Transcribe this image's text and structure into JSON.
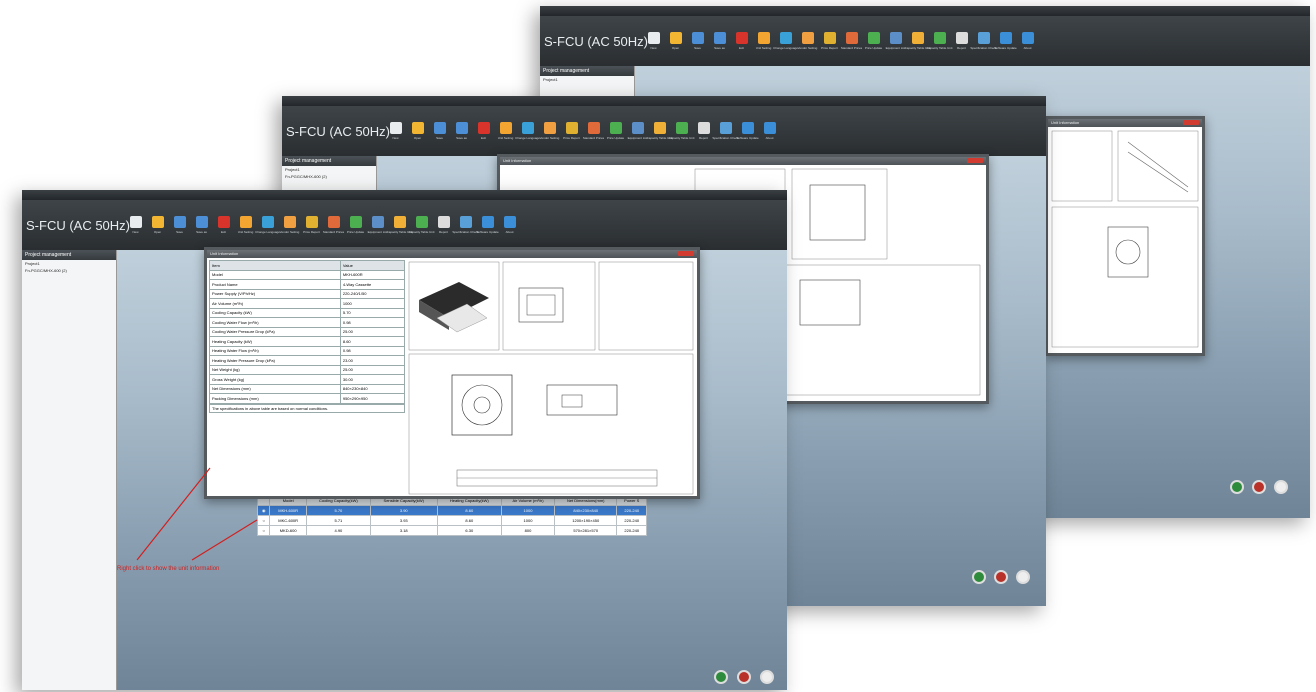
{
  "app_title": "S-FCU (AC 50Hz)",
  "toolbar": [
    "New",
    "Open",
    "Save",
    "Save as",
    "Exit",
    "Unit Setting",
    "Change Language",
    "Vendor Setting",
    "Price Report",
    "Standard Prices",
    "Price Update",
    "Equipment List",
    "Capacity Table Unit",
    "Capacity Table Unit",
    "Report",
    "Specification Check",
    "Software Update",
    "About"
  ],
  "sidebar": {
    "header": "Project management",
    "project": "Project1",
    "item": "Fn-PGGC/MHX-600 (2)"
  },
  "dialog": {
    "title": "Unit Information",
    "spec_header": [
      "Item",
      "Value"
    ],
    "specs": [
      [
        "Model",
        "MKH-600R"
      ],
      [
        "Product Name",
        "4-Way Cassette"
      ],
      [
        "Power Supply (V/Ph/Hz)",
        "220-240/1/50"
      ],
      [
        "Air Volume (m³/h)",
        "1000"
      ],
      [
        "Cooling Capacity (kW)",
        "5.70"
      ],
      [
        "Cooling Water Flow (m³/h)",
        "0.98"
      ],
      [
        "Cooling Water Pressure Drop (kPa)",
        "25.00"
      ],
      [
        "Heating Capacity (kW)",
        "8.60"
      ],
      [
        "Heating Water Flow (m³/h)",
        "0.98"
      ],
      [
        "Heating Water Pressure Drop (kPa)",
        "23.00"
      ],
      [
        "Net Weight (kg)",
        "25.00"
      ],
      [
        "Gross Weight (kg)",
        "30.00"
      ],
      [
        "Net Dimensions (mm)",
        "840×230×840"
      ],
      [
        "Packing Dimensions (mm)",
        "950×290×950"
      ]
    ],
    "footnote": "The specifications in above table are based on normal conditions."
  },
  "grid": {
    "headers": [
      "Model",
      "Cooling Capacity(kW)",
      "Sensible Capacity(kW)",
      "Heating Capacity(kW)",
      "Air Volume (m³/h)",
      "Net Dimensions(mm)",
      "Power S"
    ],
    "rows": [
      [
        "MKH-600R",
        "5.70",
        "3.90",
        "8.60",
        "1000",
        "840×230×840",
        "220-240"
      ],
      [
        "MKC-600R",
        "5.71",
        "3.93",
        "8.60",
        "1000",
        "1200×190×450",
        "220-240"
      ],
      [
        "MKD-600",
        "4.90",
        "3.18",
        "6.30",
        "800",
        "570×281×570",
        "220-240"
      ]
    ]
  },
  "annotation": "Right click to show the unit information",
  "colors": {
    "toolbar": "#2f3438",
    "selection": "#3a78c8",
    "close": "#d23b2f",
    "annotation": "#d21f1f"
  }
}
